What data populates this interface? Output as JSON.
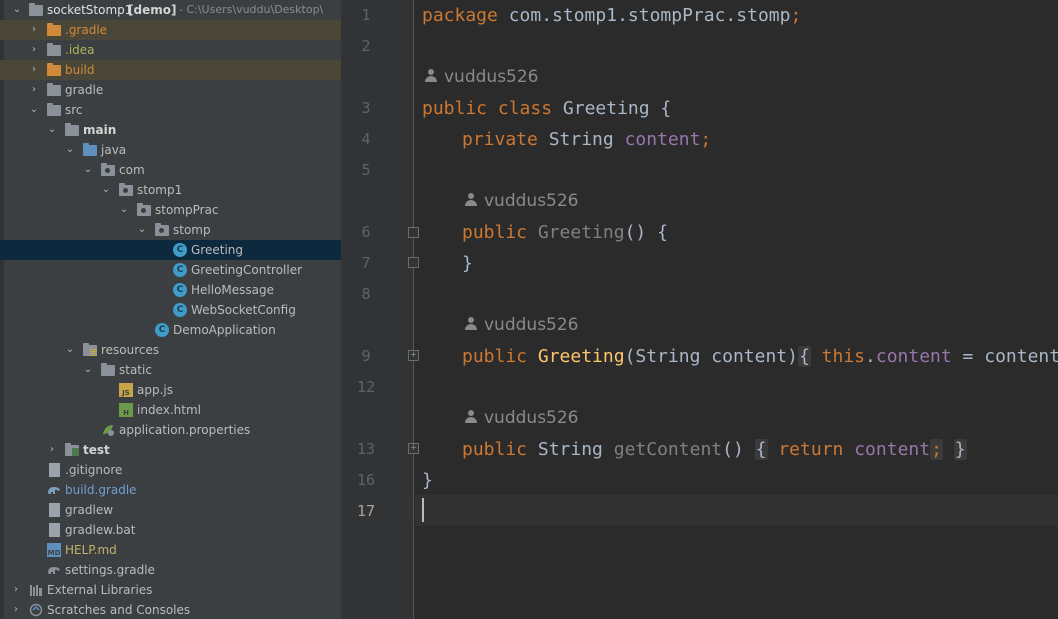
{
  "project": {
    "name": "socketStomp1",
    "module": "[demo]",
    "path": "- C:\\Users\\vuddu\\Desktop\\"
  },
  "tree": {
    "gradle_hidden": ".gradle",
    "idea": ".idea",
    "build": "build",
    "gradle": "gradle",
    "src": "src",
    "main": "main",
    "java": "java",
    "com": "com",
    "stomp1": "stomp1",
    "stompPrac": "stompPrac",
    "stomp": "stomp",
    "greeting": "Greeting",
    "greeting_controller": "GreetingController",
    "hello_message": "HelloMessage",
    "websocket_config": "WebSocketConfig",
    "demo_application": "DemoApplication",
    "resources": "resources",
    "static": "static",
    "app_js": "app.js",
    "index_html": "index.html",
    "application_properties": "application.properties",
    "test": "test",
    "gitignore": ".gitignore",
    "build_gradle": "build.gradle",
    "gradlew": "gradlew",
    "gradlew_bat": "gradlew.bat",
    "help_md": "HELP.md",
    "settings_gradle": "settings.gradle",
    "external_libraries": "External Libraries",
    "scratches": "Scratches and Consoles"
  },
  "icons": {
    "c_letter": "C",
    "js_letter": "JS",
    "html_letter": "H",
    "md_letter": "MD"
  },
  "editor": {
    "line_numbers": [
      "1",
      "2",
      "3",
      "4",
      "5",
      "6",
      "7",
      "8",
      "9",
      "12",
      "13",
      "16",
      "17"
    ],
    "author": "vuddus526",
    "tokens": {
      "package_kw": "package",
      "package_name": " com.stomp1.stompPrac.stomp",
      "semicolon": ";",
      "public": "public",
      "class": "class",
      "class_name": " Greeting {",
      "private": "private",
      "string": " String ",
      "content": "content",
      "ctor_name": "Greeting",
      "ctor_rest": "() {",
      "close_brace": "}",
      "greeting_mth": "Greeting",
      "ctor2_params": "(String content)",
      "open_brace": "{",
      "this": "this",
      "dot": ".",
      "assign": " = content",
      "string_type": "String",
      "get_content": "getContent",
      "parens": "()",
      "return": "return"
    }
  },
  "colors": {
    "keyword": "#cc7832",
    "field": "#9876aa",
    "method": "#ffc66d",
    "unused": "#808080",
    "text": "#a9b7c6",
    "selected_row": "#0d293e"
  }
}
